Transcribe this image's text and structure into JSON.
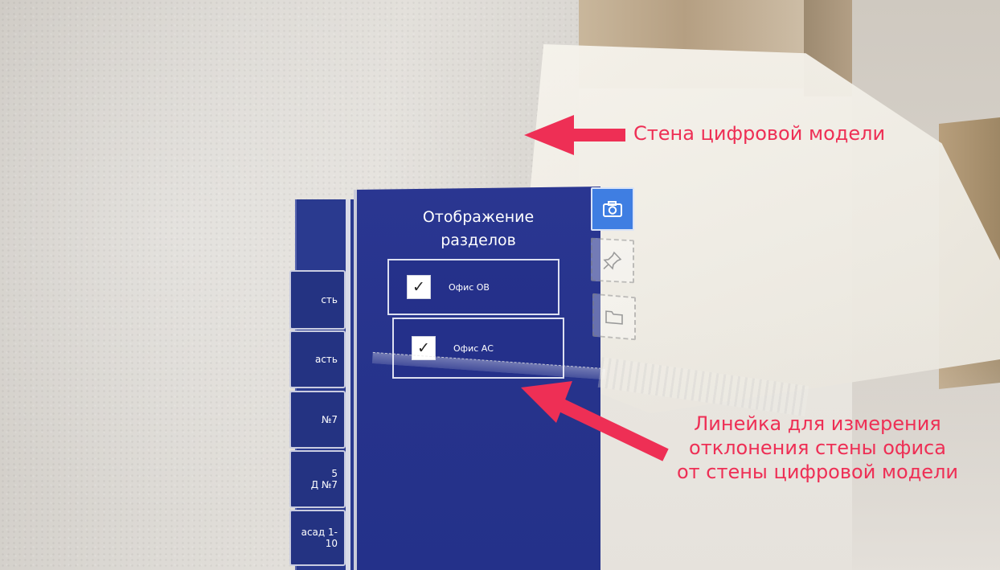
{
  "panel": {
    "title_line1": "Отображение",
    "title_line2": "разделов",
    "sections": [
      {
        "label": "Офис ОВ",
        "checked": true,
        "check_glyph": "✓"
      },
      {
        "label": "Офис АС",
        "checked": true,
        "check_glyph": "✓"
      }
    ]
  },
  "side_tabs": [
    {
      "line1": "сть",
      "line2": ""
    },
    {
      "line1": "асть",
      "line2": ""
    },
    {
      "line1": "№7",
      "line2": ""
    },
    {
      "line1": "5",
      "line2": "Д №7"
    },
    {
      "line1": "асад 1-10",
      "line2": ""
    }
  ],
  "toolbar": {
    "buttons": [
      {
        "name": "camera-icon",
        "active": true
      },
      {
        "name": "pin-icon",
        "active": false
      },
      {
        "name": "folder-icon",
        "active": false
      }
    ]
  },
  "annotations": {
    "top": "Стена цифровой модели",
    "bottom_line1": "Линейка для измерения",
    "bottom_line2": "отклонения стены офиса",
    "bottom_line3": "от стены цифровой модели"
  },
  "colors": {
    "annotation": "#ee2f55",
    "panel": "#26338b",
    "accent_button": "#3f7ee2"
  }
}
